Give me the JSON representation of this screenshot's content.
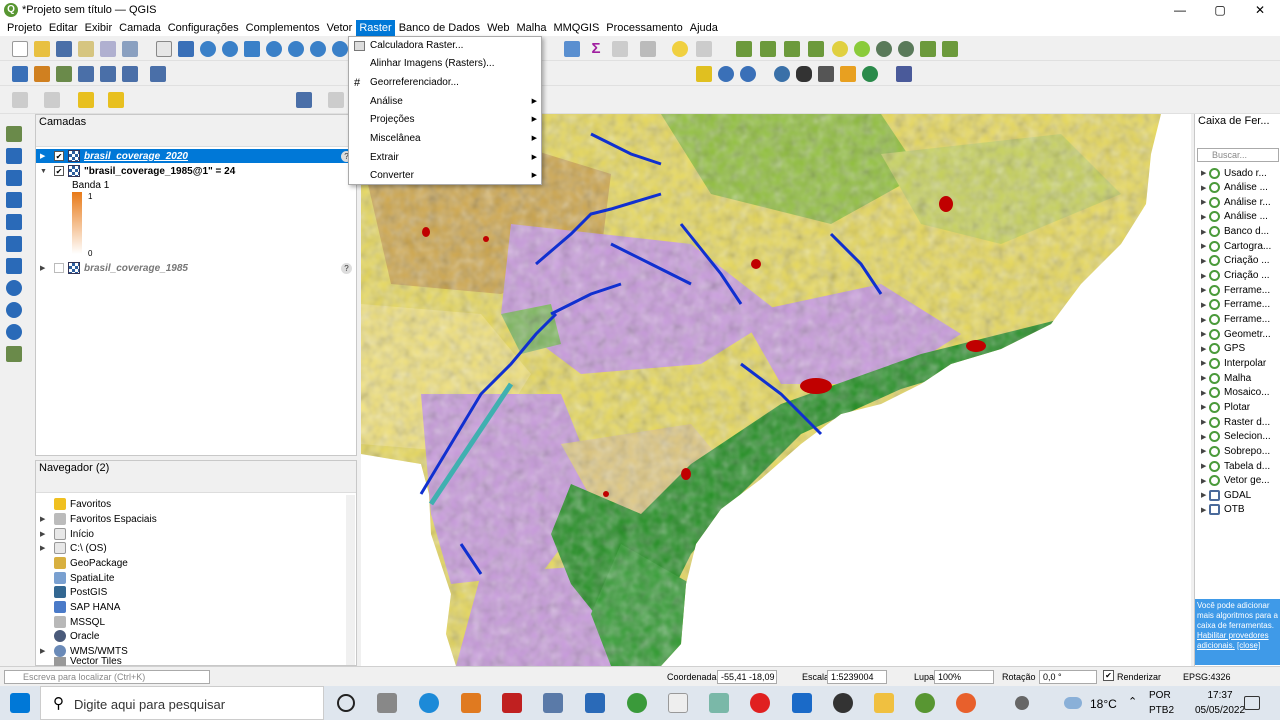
{
  "window": {
    "title": "*Projeto sem título — QGIS",
    "minimize": "—",
    "maximize": "▢",
    "close": "✕"
  },
  "menubar": [
    "Projeto",
    "Editar",
    "Exibir",
    "Camada",
    "Configurações",
    "Complementos",
    "Vetor",
    "Raster",
    "Banco de Dados",
    "Web",
    "Malha",
    "MMQGIS",
    "Processamento",
    "Ajuda"
  ],
  "raster_menu": {
    "items": [
      {
        "label": "Calculadora Raster...",
        "submenu": false
      },
      {
        "label": "Alinhar Imagens (Rasters)...",
        "submenu": false
      },
      {
        "label": "Georreferenciador...",
        "submenu": false
      },
      {
        "label": "Análise",
        "submenu": true
      },
      {
        "label": "Projeções",
        "submenu": true
      },
      {
        "label": "Miscelânea",
        "submenu": true
      },
      {
        "label": "Extrair",
        "submenu": true
      },
      {
        "label": "Converter",
        "submenu": true
      }
    ]
  },
  "layers": {
    "title": "Camadas",
    "items": [
      {
        "name": "brasil_coverage_2020",
        "checked": true,
        "selected": true
      },
      {
        "name": "\"brasil_coverage_1985@1\" = 24",
        "checked": true,
        "selected": false
      },
      {
        "name": "brasil_coverage_1985",
        "checked": false,
        "selected": false
      }
    ],
    "band_label": "Banda 1",
    "legend_max": "1",
    "legend_min": "0"
  },
  "navigator": {
    "title": "Navegador (2)",
    "items": [
      "Favoritos",
      "Favoritos Espaciais",
      "Início",
      "C:\\ (OS)",
      "GeoPackage",
      "SpatiaLite",
      "PostGIS",
      "SAP HANA",
      "MSSQL",
      "Oracle",
      "WMS/WMTS",
      "Vector Tiles"
    ]
  },
  "toolbox": {
    "title": "Caixa de Fer...",
    "search_placeholder": "Buscar...",
    "items": [
      "Usado r...",
      "Análise ...",
      "Análise r...",
      "Análise ...",
      "Banco d...",
      "Cartogra...",
      "Criação ...",
      "Criação ...",
      "Ferrame...",
      "Ferrame...",
      "Ferrame...",
      "Geometr...",
      "GPS",
      "Interpolar",
      "Malha",
      "Mosaico...",
      "Plotar",
      "Raster d...",
      "Selecion...",
      "Sobrepo...",
      "Tabela d...",
      "Vetor ge...",
      "GDAL",
      "OTB"
    ],
    "tip": "Você pode adicionar mais algoritmos para a caixa de ferramentas.",
    "tip_link": "Habilitar provedores adicionais.",
    "tip_close": "[close]"
  },
  "statusbar": {
    "locate_placeholder": "Escreva para localizar (Ctrl+K)",
    "coord_label": "Coordenada",
    "coord_value": "-55,41 -18,09",
    "scale_label": "Escala",
    "scale_value": "1:5239004",
    "lupa_label": "Lupa",
    "lupa_value": "100%",
    "rot_label": "Rotação",
    "rot_value": "0,0 °",
    "render_label": "Renderizar",
    "crs": "EPSG:4326"
  },
  "taskbar": {
    "search_placeholder": "Digite aqui para pesquisar",
    "temp": "18°C",
    "lang": "POR",
    "layout": "PTB2",
    "time": "17:37",
    "date": "05/05/2022"
  },
  "colors": {
    "accent": "#0078d7",
    "forest": "#1f8d1f",
    "savanna": "#e8d95a",
    "pasture": "#f2e27a",
    "agri": "#c89adc",
    "water": "#1030d0",
    "urban": "#c00000",
    "wetland": "#7ab65a"
  }
}
